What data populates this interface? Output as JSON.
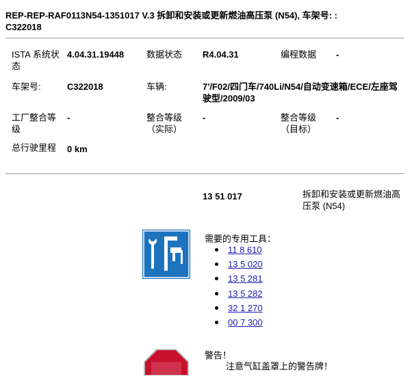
{
  "document": {
    "title": "REP-REP-RAF0113N54-1351017   V.3   拆卸和安装或更新燃油高压泵 (N54), 车架号: : C322018"
  },
  "info_table": {
    "ista_label": "ISTA 系统状态",
    "ista_value": "4.04.31.19448",
    "data_status_label": "数据状态",
    "data_status_value": "R4.04.31",
    "programming_label": "编程数据",
    "programming_value": "-",
    "chassis_label": "车架号:",
    "chassis_value": "C322018",
    "vehicle_label": "车辆:",
    "vehicle_value": "7'/F02/四门车/740Li/N54/自动变速箱/ECE/左座驾驶型/2009/03",
    "factory_label": "工厂整合等级",
    "factory_value": "-",
    "integration_actual_label": "整合等级（实际）",
    "integration_actual_value": "-",
    "integration_target_label": "整合等级（目标）",
    "integration_target_value": "-",
    "mileage_label": "总行驶里程",
    "mileage_value": "0 km"
  },
  "procedure": {
    "number": "13 51 017",
    "title": "拆卸和安装或更新燃油高压泵 (N54)"
  },
  "special_tools": {
    "icon": "tools-icon",
    "heading": "需要的专用工具：",
    "items": [
      "11 8 610",
      "13 5 020",
      "13 5 281",
      "13 5 282",
      "32 1 270",
      "00 7 300"
    ]
  },
  "warning": {
    "icon": "stop-sign-icon",
    "heading": "警告！",
    "text": "注意气缸盖罩上的警告牌！"
  },
  "colors": {
    "link": "#1a1ab0",
    "icon_blue": "#1e73be",
    "stop_red": "#c8102e",
    "rule": "#9a9a9a"
  }
}
